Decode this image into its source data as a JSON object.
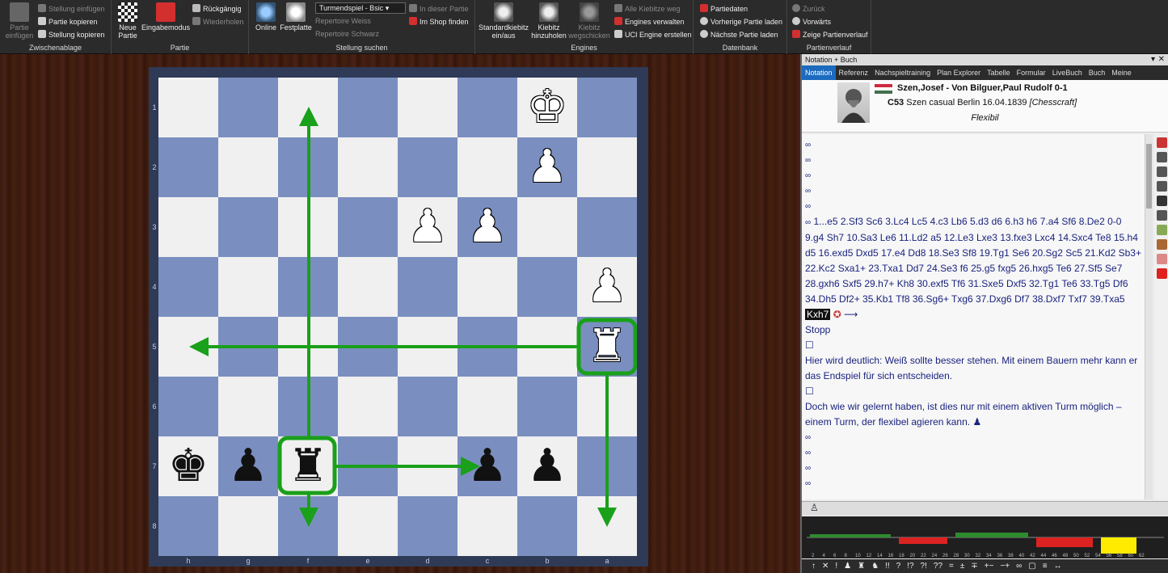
{
  "ribbon": {
    "zwischenablage": {
      "label": "Zwischenablage",
      "partie_einfuegen": "Partie einfügen",
      "stellung_einfuegen": "Stellung einfügen",
      "partie_kopieren": "Partie kopieren",
      "stellung_kopieren": "Stellung kopieren"
    },
    "partie": {
      "label": "Partie",
      "neue_partie": "Neue Partie",
      "eingabemodus": "Eingabemodus",
      "rueckgaengig": "Rückgängig",
      "wiederholen": "Wiederholen"
    },
    "stellung_suchen": {
      "label": "Stellung suchen",
      "online": "Online",
      "festplatte": "Festplatte",
      "dropdown_value": "Turmendspiel - Bsic",
      "repertoire_weiss": "Repertoire Weiss",
      "repertoire_schwarz": "Repertoire Schwarz",
      "in_dieser_partie": "In dieser Partie",
      "im_shop_finden": "Im Shop finden"
    },
    "engines": {
      "label": "Engines",
      "standardkiebitz": "Standardkiebitz ein/aus",
      "kiebitz_hinzuholen": "Kiebitz hinzuholen",
      "kiebitz_wegschicken": "Kiebitz wegschicken",
      "alle_kiebitze_weg": "Alle Kiebitze weg",
      "engines_verwalten": "Engines verwalten",
      "uci_engine_erstellen": "UCI Engine erstellen"
    },
    "datenbank": {
      "label": "Datenbank",
      "partiedaten": "Partiedaten",
      "vorherige_partie": "Vorherige Partie laden",
      "naechste_partie": "Nächste Partie laden"
    },
    "partienverlauf": {
      "label": "Partienverlauf",
      "zurueck": "Zurück",
      "vorwaerts": "Vorwärts",
      "zeige_partienverlauf": "Zeige Partienverlauf"
    }
  },
  "board": {
    "rank_labels": [
      "1",
      "2",
      "3",
      "4",
      "5",
      "6",
      "7",
      "8"
    ],
    "file_labels": [
      "h",
      "g",
      "f",
      "e",
      "d",
      "c",
      "b",
      "a"
    ],
    "pieces": [
      {
        "glyph": "♚",
        "color": "white",
        "col": 6,
        "row": 0,
        "name": "white-king"
      },
      {
        "glyph": "♟",
        "color": "white",
        "col": 6,
        "row": 1,
        "name": "white-pawn-b2"
      },
      {
        "glyph": "♟",
        "color": "white",
        "col": 4,
        "row": 2,
        "name": "white-pawn-d3"
      },
      {
        "glyph": "♟",
        "color": "white",
        "col": 5,
        "row": 2,
        "name": "white-pawn-c3"
      },
      {
        "glyph": "♟",
        "color": "white",
        "col": 7,
        "row": 3,
        "name": "white-pawn-a4"
      },
      {
        "glyph": "♜",
        "color": "white",
        "col": 7,
        "row": 4,
        "name": "white-rook-a5"
      },
      {
        "glyph": "♚",
        "color": "black",
        "col": 0,
        "row": 6,
        "name": "black-king"
      },
      {
        "glyph": "♟",
        "color": "black",
        "col": 1,
        "row": 6,
        "name": "black-pawn-g7"
      },
      {
        "glyph": "♜",
        "color": "black",
        "col": 2,
        "row": 6,
        "name": "black-rook-f7"
      },
      {
        "glyph": "♟",
        "color": "black",
        "col": 5,
        "row": 6,
        "name": "black-pawn-c7"
      },
      {
        "glyph": "♟",
        "color": "black",
        "col": 6,
        "row": 6,
        "name": "black-pawn-b7"
      }
    ],
    "arrow_color": "#1aa01a"
  },
  "panel": {
    "title": "Notation + Buch",
    "tabs": [
      "Notation",
      "Referenz",
      "Nachspieltraining",
      "Plan Explorer",
      "Tabelle",
      "Formular",
      "LiveBuch",
      "Buch",
      "Meine"
    ],
    "players": "Szen,Josef - Von Bilguer,Paul Rudolf  0-1",
    "eco": "C53",
    "event": "Szen casual Berlin 16.04.1839",
    "source": "[Chesscraft]",
    "opening_tag": "Flexibil",
    "moves": "1...e5 2.Sf3 Sc6 3.Lc4 Lc5 4.c3 Lb6 5.d3 d6 6.h3 h6 7.a4 Sf6 8.De2 0-0 9.g4 Sh7 10.Sa3 Le6 11.Ld2 a5 12.Le3 Lxe3 13.fxe3 Lxc4 14.Sxc4 Te8 15.h4 d5 16.exd5 Dxd5 17.e4 Dd8 18.Se3 Sf8 19.Tg1 Se6 20.Sg2 Sc5 21.Kd2 Sb3+ 22.Kc2 Sxa1+ 23.Txa1 Dd7 24.Se3 f6 25.g5 fxg5 26.hxg5 Te6 27.Sf5 Se7 28.gxh6 Sxf5 29.h7+ Kh8 30.exf5 Tf6 31.Sxe5 Dxf5 32.Tg1 Te6 33.Tg5 Df6 34.Dh5 Df2+ 35.Kb1 Tf8 36.Sg6+ Txg6 37.Dxg6 Df7 38.Dxf7 Txf7 39.Txa5",
    "current_move": "Kxh7",
    "stopp": "Stopp",
    "comment1": "Hier wird deutlich: Weiß sollte besser stehen. Mit einem Bauern mehr kann er das Endspiel für sich entscheiden.",
    "comment2": "Doch wie wir gelernt haben, ist dies nur mit einem aktiven Turm möglich – einem Turm, der flexibel agieren kann.",
    "fold_marker": "∞",
    "box_marker": "☐",
    "eval_ticks": [
      "2",
      "4",
      "6",
      "8",
      "10",
      "12",
      "14",
      "16",
      "18",
      "20",
      "22",
      "24",
      "26",
      "28",
      "30",
      "32",
      "34",
      "36",
      "38",
      "40",
      "42",
      "44",
      "46",
      "48",
      "50",
      "52",
      "54",
      "56",
      "58",
      "60",
      "62"
    ],
    "annotation_symbols": [
      "↑",
      "✕",
      "!",
      "♟",
      "♜",
      "♞",
      "!!",
      "?",
      "!?",
      "?!",
      "??",
      "=",
      "±",
      "∓",
      "+−",
      "−+",
      "∞",
      "▢",
      "≡",
      "↔"
    ]
  }
}
